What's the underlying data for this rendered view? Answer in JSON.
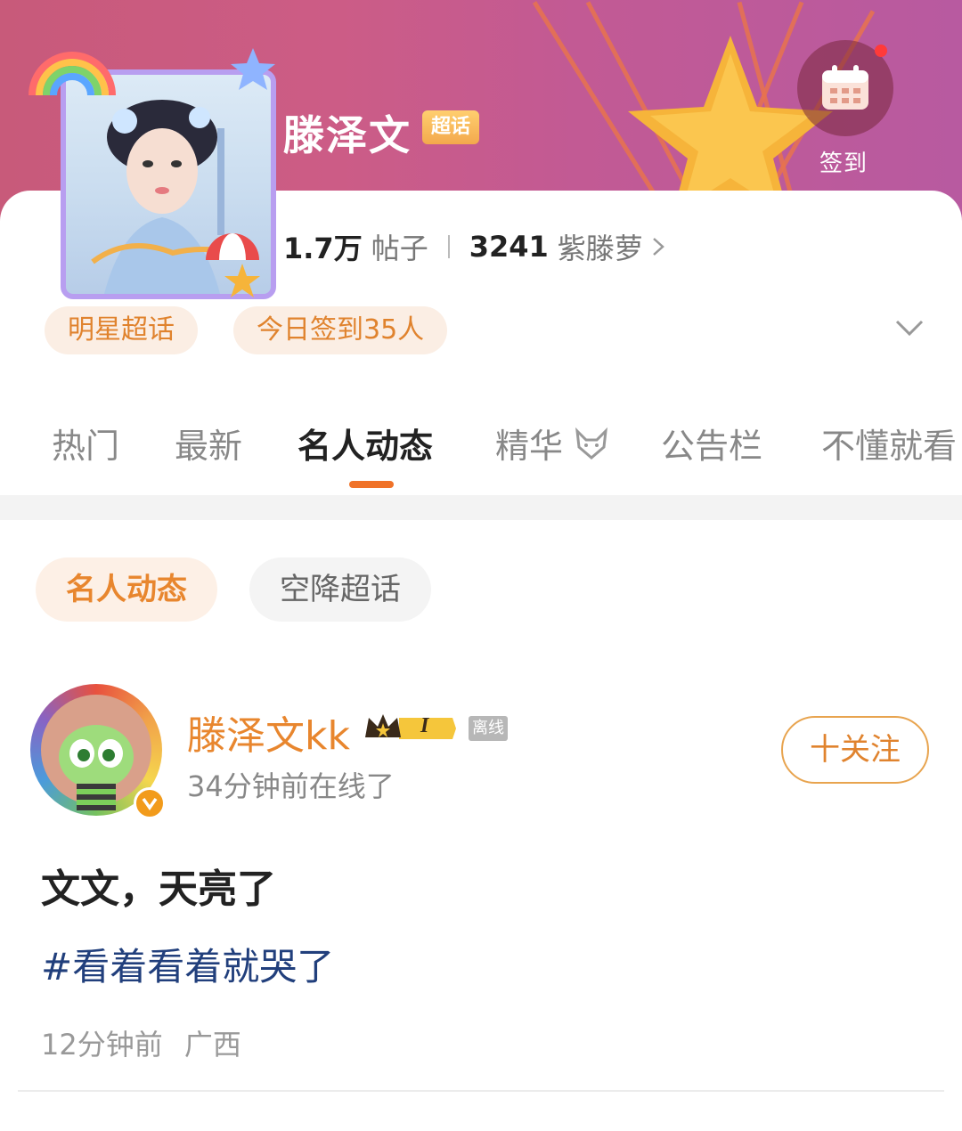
{
  "header": {
    "topic_name": "滕泽文",
    "badge": "超话",
    "signin_label": "签到",
    "colors": {
      "banner": "#c85a7a",
      "accent": "#f07228"
    }
  },
  "stats": {
    "posts_count": "1.7万",
    "posts_label": "帖子",
    "fans_count": "3241",
    "fans_label": "紫滕萝"
  },
  "chips": {
    "category": "明星超话",
    "signin_today": "今日签到35人"
  },
  "tabs": [
    {
      "label": "热门"
    },
    {
      "label": "最新"
    },
    {
      "label": "名人动态"
    },
    {
      "label": "精华"
    },
    {
      "label": "公告栏"
    },
    {
      "label": "不懂就看"
    }
  ],
  "subtabs": {
    "active": "名人动态",
    "other": "空降超话"
  },
  "post": {
    "username": "滕泽文kk",
    "level_badge": "I",
    "offline_tag": "离线",
    "online_time": "34分钟前在线了",
    "follow_label": "十关注",
    "text": "文文，天亮了",
    "hashtag": "#看着看着就哭了",
    "time": "12分钟前",
    "location": "广西"
  }
}
